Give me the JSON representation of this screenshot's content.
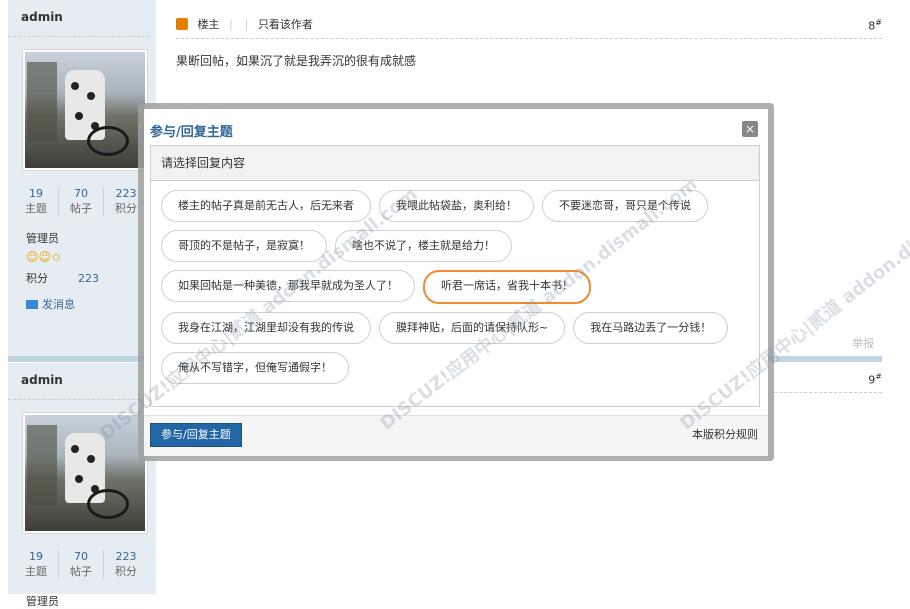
{
  "post1": {
    "username": "admin",
    "stats": [
      {
        "value": "19",
        "label": "主题"
      },
      {
        "value": "70",
        "label": "帖子"
      },
      {
        "value": "223",
        "label": "积分"
      }
    ],
    "role": "管理员",
    "points_label": "积分",
    "points_value": "223",
    "send_message": "发消息",
    "author_badge": "楼主",
    "only_author": "只看该作者",
    "floor": "8",
    "content": "果断回帖，如果沉了就是我弄沉的很有成就感",
    "report": "举报"
  },
  "post2": {
    "username": "admin",
    "stats": [
      {
        "value": "19",
        "label": "主题"
      },
      {
        "value": "70",
        "label": "帖子"
      },
      {
        "value": "223",
        "label": "积分"
      }
    ],
    "role": "管理员",
    "floor": "9"
  },
  "dialog": {
    "title": "参与/回复主题",
    "close_icon": "×",
    "prompt": "请选择回复内容",
    "options": [
      "楼主的帖子真是前无古人，后无来者",
      "我喂此帖袋盐，奥利给！",
      "不要迷恋哥，哥只是个传说",
      "哥顶的不是帖子，是寂寞！",
      "啥也不说了，楼主就是给力！",
      "如果回帖是一种美德，那我早就成为圣人了！",
      "听君一席话，省我十本书！",
      "我身在江湖，江湖里却没有我的传说",
      "膜拜神贴，后面的请保持队形~",
      "我在马路边丢了一分钱！",
      "俺从不写错字，但俺写通假字！"
    ],
    "selected_index": 6,
    "submit": "参与/回复主题",
    "rules": "本版积分规则"
  },
  "watermark": "DISCUZ!应用中心|贰道 addon.dismall.com"
}
